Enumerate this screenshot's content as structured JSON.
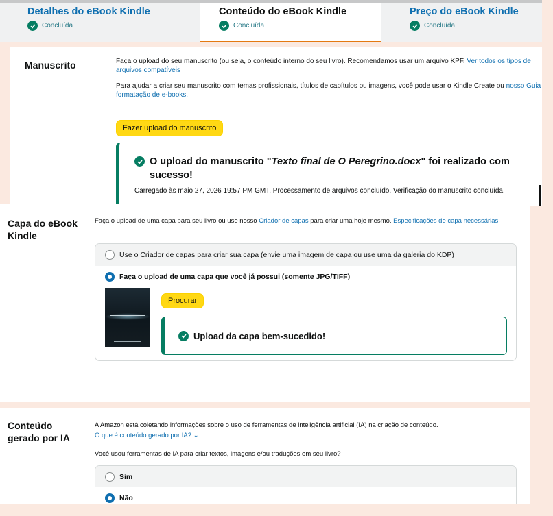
{
  "tabs": [
    {
      "title": "Detalhes do eBook Kindle",
      "status": "Concluída"
    },
    {
      "title": "Conteúdo do eBook Kindle",
      "status": "Concluída"
    },
    {
      "title": "Preço do eBook Kindle",
      "status": "Concluída"
    }
  ],
  "manuscript": {
    "title": "Manuscrito",
    "p1_text": "Faça o upload do seu manuscrito (ou seja, o conteúdo interno do seu livro). Recomendamos usar um arquivo KPF. ",
    "p1_link": "Ver todos os tipos de arquivos compatíveis",
    "p2_text": "Para ajudar a criar seu manuscrito com temas profissionais, títulos de capítulos ou imagens, você pode usar o Kindle Create ou ",
    "p2_link": "nosso Guia de formatação de e-books.",
    "upload_button": "Fazer upload do manuscrito",
    "alert_prefix": "O upload do manuscrito \"",
    "alert_filename": "Texto final de O Peregrino.docx",
    "alert_suffix": "\" foi realizado com sucesso!",
    "alert_detail": "Carregado às maio 27, 2026 19:57 PM GMT. Processamento de arquivos concluído. Verificação do manuscrito concluída."
  },
  "cover": {
    "title": "Capa do eBook Kindle",
    "intro_text": "Faça o upload de uma capa para seu livro ou use nosso ",
    "intro_link1": "Criador de capas",
    "intro_mid": " para criar uma hoje mesmo. ",
    "intro_link2": "Especificações de capa necessárias",
    "option_creator": "Use o Criador de capas para criar sua capa (envie uma imagem de capa ou use uma da galeria do KDP)",
    "option_upload": "Faça o upload de uma capa que você já possui (somente JPG/TIFF)",
    "browse_button": "Procurar",
    "success_message": "Upload da capa bem-sucedido!"
  },
  "ai_content": {
    "title": "Conteúdo gerado por IA",
    "intro": "A Amazon está coletando informações sobre o uso de ferramentas de inteligência artificial (IA) na criação de conteúdo.",
    "link": "O que é conteúdo gerado por IA? ⌄",
    "question": "Você usou ferramentas de IA para criar textos, imagens e/ou traduções em seu livro?",
    "option_yes": "Sim",
    "option_no": "Não"
  },
  "colors": {
    "accent_link": "#0f6fb0",
    "success_green": "#067d62",
    "button_yellow": "#ffd814",
    "active_tab_underline": "#e47911",
    "page_background": "#fbe9e0"
  }
}
